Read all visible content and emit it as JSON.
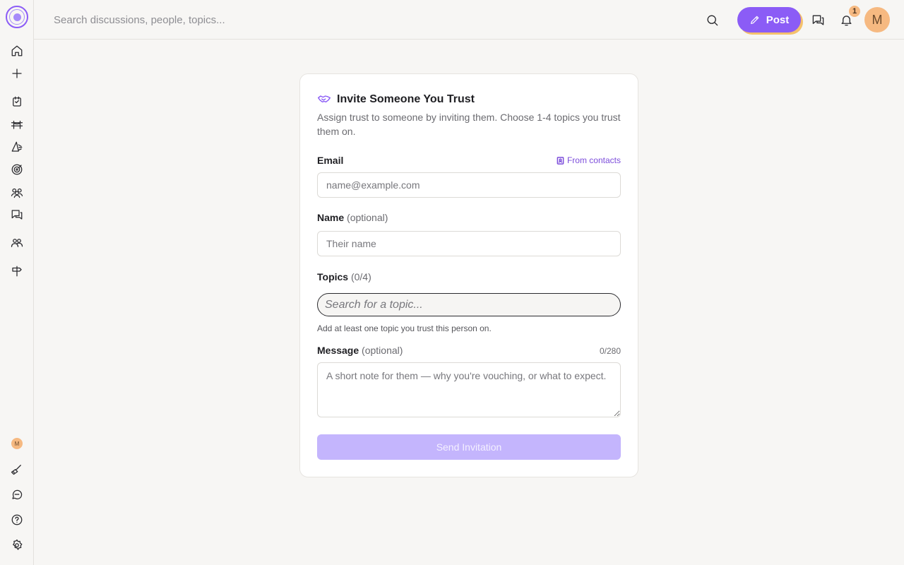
{
  "topbar": {
    "search_placeholder": "Search discussions, people, topics...",
    "post_label": "Post",
    "notification_count": "1",
    "avatar_initial": "M"
  },
  "sidebar": {
    "avatar_initial": "M",
    "items": [
      {
        "icon": "home-icon"
      },
      {
        "icon": "plus-icon"
      },
      {
        "icon": "inbox-icon"
      },
      {
        "icon": "bridge-icon"
      },
      {
        "icon": "sail-icon"
      },
      {
        "icon": "target-icon"
      },
      {
        "icon": "people-icon"
      },
      {
        "icon": "chat-icon"
      },
      {
        "icon": "group-icon"
      },
      {
        "icon": "signpost-icon"
      }
    ],
    "bottom_items": [
      {
        "icon": "broom-icon"
      },
      {
        "icon": "message-circle-icon"
      },
      {
        "icon": "help-icon"
      },
      {
        "icon": "settings-icon"
      }
    ]
  },
  "form": {
    "title": "Invite Someone You Trust",
    "description": "Assign trust to someone by inviting them. Choose 1-4 topics you trust them on.",
    "email_label": "Email",
    "from_contacts": "From contacts",
    "email_placeholder": "name@example.com",
    "name_label": "Name",
    "name_optional": "(optional)",
    "name_placeholder": "Their name",
    "topics_label": "Topics",
    "topics_count": "(0/4)",
    "topic_placeholder": "Search for a topic...",
    "topics_hint": "Add at least one topic you trust this person on.",
    "message_label": "Message",
    "message_optional": "(optional)",
    "message_counter": "0/280",
    "message_placeholder": "A short note for them — why you're vouching, or what to expect.",
    "send_label": "Send Invitation"
  },
  "colors": {
    "accent": "#8b5cf6",
    "accent_disabled": "#c4b5fd",
    "avatar": "#f6b981",
    "background": "#f7f6f4"
  }
}
